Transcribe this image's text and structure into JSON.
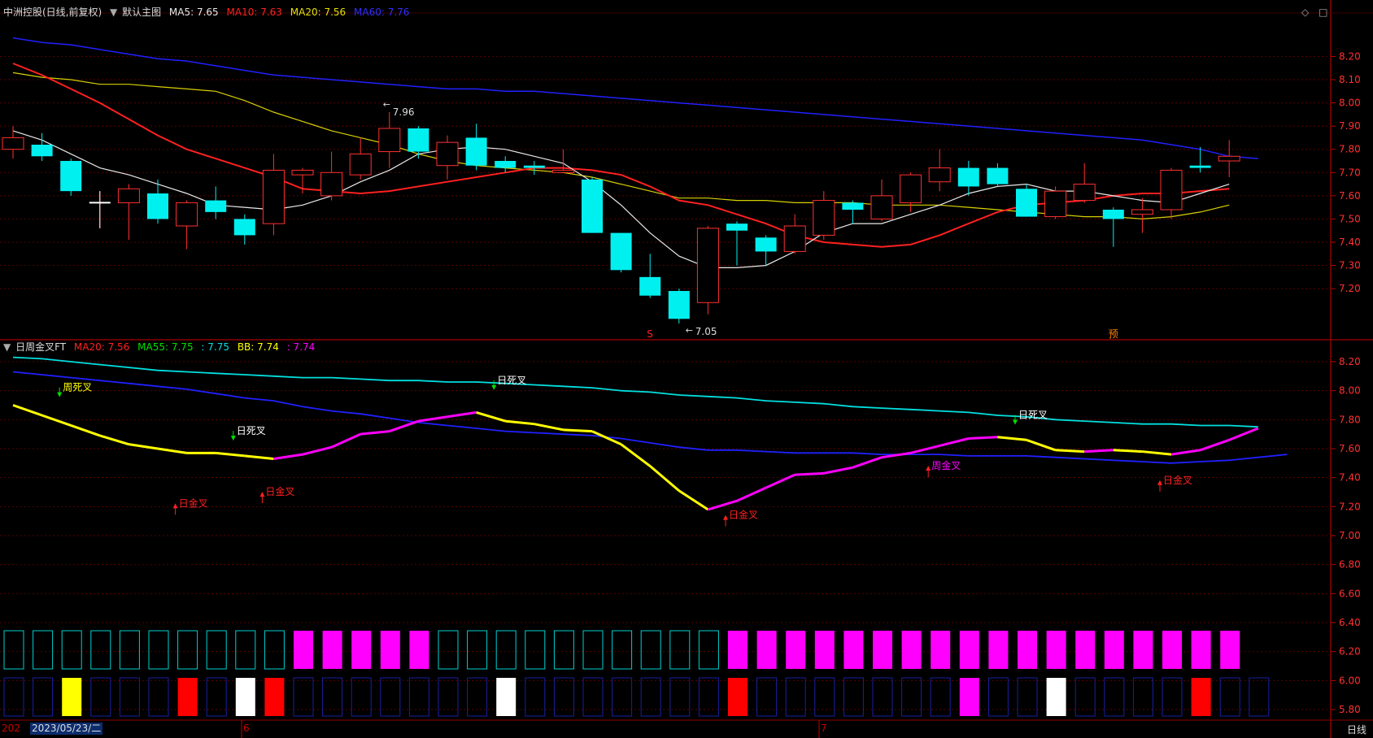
{
  "window": {
    "top_controls": [
      "◇",
      "□"
    ]
  },
  "main_panel": {
    "header": {
      "title": "中洲控股(日线,前复权)",
      "theme": "默认主图",
      "ma5": "MA5: 7.65",
      "ma10": "MA10: 7.63",
      "ma20": "MA20: 7.56",
      "ma60": "MA60: 7.76"
    },
    "colors": {
      "ma5": "#e8e8e8",
      "ma10": "#ff2020",
      "ma20": "#d8d000",
      "ma60": "#2020ff",
      "up": "#ff3030",
      "down": "#00f0f0"
    },
    "high_label": "7.96",
    "low_label": "7.05",
    "markers": [
      {
        "label": "S",
        "color": "#ff2020"
      },
      {
        "label": "预",
        "color": "#ff8000"
      }
    ]
  },
  "sub_panel": {
    "header": {
      "title": "日周金叉FT",
      "ma20": "MA20: 7.56",
      "ma55": "MA55: 7.75",
      "unnamed": ": 7.75",
      "bb": "BB: 7.74",
      "value": ": 7.74"
    },
    "signal_labels": [
      {
        "text": "周死叉",
        "color": "#ffff00",
        "arrow": "down"
      },
      {
        "text": "日死叉",
        "color": "#ffffff",
        "arrow": "down"
      },
      {
        "text": "日金叉",
        "color": "#ff2020",
        "arrow": "up"
      },
      {
        "text": "日金叉",
        "color": "#ff2020",
        "arrow": "up"
      },
      {
        "text": "日死叉",
        "color": "#ffffff",
        "arrow": "down"
      },
      {
        "text": "日金叉",
        "color": "#ff2020",
        "arrow": "up"
      },
      {
        "text": "周金叉",
        "color": "#ff00ff",
        "arrow": "up"
      },
      {
        "text": "日死叉",
        "color": "#ffffff",
        "arrow": "down"
      },
      {
        "text": "日金叉",
        "color": "#ff2020",
        "arrow": "up"
      }
    ]
  },
  "axis": {
    "main_ticks": [
      "8.20",
      "8.10",
      "8.00",
      "7.90",
      "7.80",
      "7.70",
      "7.60",
      "7.50",
      "7.40",
      "7.30",
      "7.20"
    ],
    "sub_ticks": [
      "8.20",
      "8.00",
      "7.80",
      "7.60",
      "7.40",
      "7.20",
      "7.00",
      "6.80",
      "6.60",
      "6.40",
      "6.20",
      "6.00",
      "5.80"
    ]
  },
  "bottom_bar": {
    "year_stub": "202",
    "cursor_date": "2023/05/23/二",
    "month_labels": [
      "6",
      "7"
    ],
    "period": "日线"
  },
  "chart_data": {
    "type": "candlestick",
    "candles": [
      {
        "o": 7.8,
        "c": 7.85,
        "h": 7.9,
        "l": 7.76
      },
      {
        "o": 7.82,
        "c": 7.77,
        "h": 7.87,
        "l": 7.75
      },
      {
        "o": 7.75,
        "c": 7.62,
        "h": 7.76,
        "l": 7.6
      },
      {
        "o": 7.57,
        "c": 7.57,
        "h": 7.62,
        "l": 7.46
      },
      {
        "o": 7.57,
        "c": 7.63,
        "h": 7.65,
        "l": 7.41
      },
      {
        "o": 7.61,
        "c": 7.5,
        "h": 7.67,
        "l": 7.48
      },
      {
        "o": 7.47,
        "c": 7.57,
        "h": 7.58,
        "l": 7.37
      },
      {
        "o": 7.58,
        "c": 7.53,
        "h": 7.64,
        "l": 7.5
      },
      {
        "o": 7.5,
        "c": 7.43,
        "h": 7.52,
        "l": 7.39
      },
      {
        "o": 7.48,
        "c": 7.71,
        "h": 7.78,
        "l": 7.43
      },
      {
        "o": 7.69,
        "c": 7.71,
        "h": 7.72,
        "l": 7.61
      },
      {
        "o": 7.6,
        "c": 7.7,
        "h": 7.79,
        "l": 7.58
      },
      {
        "o": 7.69,
        "c": 7.78,
        "h": 7.85,
        "l": 7.67
      },
      {
        "o": 7.79,
        "c": 7.89,
        "h": 7.96,
        "l": 7.72
      },
      {
        "o": 7.89,
        "c": 7.79,
        "h": 7.9,
        "l": 7.76
      },
      {
        "o": 7.73,
        "c": 7.83,
        "h": 7.86,
        "l": 7.67
      },
      {
        "o": 7.85,
        "c": 7.73,
        "h": 7.91,
        "l": 7.71
      },
      {
        "o": 7.75,
        "c": 7.72,
        "h": 7.77,
        "l": 7.7
      },
      {
        "o": 7.73,
        "c": 7.72,
        "h": 7.75,
        "l": 7.69
      },
      {
        "o": 7.7,
        "c": 7.71,
        "h": 7.8,
        "l": 7.7
      },
      {
        "o": 7.67,
        "c": 7.44,
        "h": 7.68,
        "l": 7.44
      },
      {
        "o": 7.44,
        "c": 7.28,
        "h": 7.44,
        "l": 7.27
      },
      {
        "o": 7.25,
        "c": 7.17,
        "h": 7.35,
        "l": 7.16
      },
      {
        "o": 7.19,
        "c": 7.07,
        "h": 7.2,
        "l": 7.05
      },
      {
        "o": 7.14,
        "c": 7.46,
        "h": 7.47,
        "l": 7.09
      },
      {
        "o": 7.48,
        "c": 7.45,
        "h": 7.49,
        "l": 7.3
      },
      {
        "o": 7.42,
        "c": 7.36,
        "h": 7.43,
        "l": 7.3
      },
      {
        "o": 7.36,
        "c": 7.47,
        "h": 7.52,
        "l": 7.35
      },
      {
        "o": 7.43,
        "c": 7.58,
        "h": 7.62,
        "l": 7.41
      },
      {
        "o": 7.57,
        "c": 7.54,
        "h": 7.58,
        "l": 7.48
      },
      {
        "o": 7.5,
        "c": 7.6,
        "h": 7.67,
        "l": 7.49
      },
      {
        "o": 7.57,
        "c": 7.69,
        "h": 7.7,
        "l": 7.53
      },
      {
        "o": 7.66,
        "c": 7.72,
        "h": 7.8,
        "l": 7.62
      },
      {
        "o": 7.72,
        "c": 7.64,
        "h": 7.75,
        "l": 7.6
      },
      {
        "o": 7.72,
        "c": 7.65,
        "h": 7.74,
        "l": 7.64
      },
      {
        "o": 7.63,
        "c": 7.51,
        "h": 7.65,
        "l": 7.51
      },
      {
        "o": 7.51,
        "c": 7.62,
        "h": 7.64,
        "l": 7.5
      },
      {
        "o": 7.58,
        "c": 7.65,
        "h": 7.74,
        "l": 7.57
      },
      {
        "o": 7.54,
        "c": 7.5,
        "h": 7.55,
        "l": 7.38
      },
      {
        "o": 7.52,
        "c": 7.54,
        "h": 7.59,
        "l": 7.44
      },
      {
        "o": 7.54,
        "c": 7.71,
        "h": 7.72,
        "l": 7.5
      },
      {
        "o": 7.73,
        "c": 7.72,
        "h": 7.81,
        "l": 7.7
      },
      {
        "o": 7.75,
        "c": 7.77,
        "h": 7.84,
        "l": 7.68
      }
    ],
    "ma5": [
      7.88,
      7.84,
      7.78,
      7.72,
      7.69,
      7.65,
      7.61,
      7.56,
      7.55,
      7.54,
      7.56,
      7.6,
      7.66,
      7.71,
      7.78,
      7.8,
      7.81,
      7.8,
      7.77,
      7.74,
      7.66,
      7.56,
      7.44,
      7.34,
      7.29,
      7.29,
      7.3,
      7.36,
      7.44,
      7.48,
      7.48,
      7.52,
      7.56,
      7.61,
      7.64,
      7.65,
      7.62,
      7.62,
      7.6,
      7.58,
      7.57,
      7.61,
      7.65
    ],
    "ma10": [
      8.17,
      8.12,
      8.06,
      8.0,
      7.93,
      7.86,
      7.8,
      7.76,
      7.72,
      7.68,
      7.63,
      7.62,
      7.61,
      7.62,
      7.64,
      7.66,
      7.68,
      7.7,
      7.72,
      7.72,
      7.71,
      7.69,
      7.64,
      7.58,
      7.56,
      7.52,
      7.48,
      7.43,
      7.4,
      7.39,
      7.38,
      7.39,
      7.43,
      7.48,
      7.53,
      7.56,
      7.57,
      7.58,
      7.6,
      7.61,
      7.61,
      7.62,
      7.63
    ],
    "ma20": [
      8.13,
      8.11,
      8.1,
      8.08,
      8.08,
      8.07,
      8.06,
      8.05,
      8.01,
      7.96,
      7.92,
      7.88,
      7.85,
      7.82,
      7.78,
      7.75,
      7.73,
      7.72,
      7.71,
      7.7,
      7.68,
      7.65,
      7.62,
      7.59,
      7.59,
      7.58,
      7.58,
      7.57,
      7.57,
      7.57,
      7.56,
      7.56,
      7.56,
      7.55,
      7.54,
      7.53,
      7.52,
      7.51,
      7.51,
      7.5,
      7.51,
      7.53,
      7.56
    ],
    "ma60": [
      8.28,
      8.26,
      8.25,
      8.23,
      8.21,
      8.19,
      8.18,
      8.16,
      8.14,
      8.12,
      8.11,
      8.1,
      8.09,
      8.08,
      8.07,
      8.06,
      8.06,
      8.05,
      8.05,
      8.04,
      8.03,
      8.02,
      8.01,
      8.0,
      7.99,
      7.98,
      7.97,
      7.96,
      7.95,
      7.94,
      7.93,
      7.92,
      7.91,
      7.9,
      7.89,
      7.88,
      7.87,
      7.86,
      7.85,
      7.84,
      7.82,
      7.8,
      7.77,
      7.76
    ],
    "sub": {
      "ma55": [
        8.23,
        8.22,
        8.2,
        8.18,
        8.16,
        8.14,
        8.13,
        8.12,
        8.11,
        8.1,
        8.09,
        8.09,
        8.08,
        8.07,
        8.07,
        8.06,
        8.06,
        8.05,
        8.04,
        8.03,
        8.02,
        8.0,
        7.99,
        7.97,
        7.96,
        7.95,
        7.93,
        7.92,
        7.91,
        7.89,
        7.88,
        7.87,
        7.86,
        7.85,
        7.83,
        7.82,
        7.8,
        7.79,
        7.78,
        7.77,
        7.77,
        7.76,
        7.76,
        7.75
      ],
      "ma20": [
        8.13,
        8.11,
        8.09,
        8.07,
        8.05,
        8.03,
        8.01,
        7.98,
        7.95,
        7.93,
        7.89,
        7.86,
        7.84,
        7.81,
        7.78,
        7.76,
        7.74,
        7.72,
        7.71,
        7.7,
        7.69,
        7.67,
        7.64,
        7.61,
        7.59,
        7.59,
        7.58,
        7.57,
        7.57,
        7.57,
        7.56,
        7.56,
        7.56,
        7.55,
        7.55,
        7.55,
        7.54,
        7.53,
        7.52,
        7.51,
        7.5,
        7.51,
        7.52,
        7.54,
        7.56
      ],
      "bb": [
        7.9,
        7.83,
        7.76,
        7.69,
        7.63,
        7.6,
        7.57,
        7.57,
        7.55,
        7.53,
        7.56,
        7.61,
        7.7,
        7.72,
        7.79,
        7.82,
        7.85,
        7.79,
        7.77,
        7.73,
        7.72,
        7.63,
        7.48,
        7.31,
        7.18,
        7.24,
        7.33,
        7.42,
        7.43,
        7.47,
        7.54,
        7.57,
        7.62,
        7.67,
        7.68,
        7.66,
        7.59,
        7.58,
        7.59,
        7.58,
        7.56,
        7.59,
        7.66,
        7.74
      ],
      "week_bars": [
        0,
        0,
        0,
        0,
        0,
        0,
        0,
        0,
        0,
        0,
        1,
        1,
        1,
        1,
        1,
        0,
        0,
        0,
        0,
        0,
        0,
        0,
        0,
        0,
        0,
        1,
        1,
        1,
        1,
        1,
        1,
        1,
        1,
        1,
        1,
        1,
        1,
        1,
        1,
        1,
        1,
        1,
        1
      ],
      "day_bars": [
        "",
        "",
        "yellow",
        "",
        "",
        "",
        "red",
        "",
        "white",
        "red",
        "",
        "",
        "",
        "",
        "",
        "",
        "",
        "white",
        "",
        "",
        "",
        "",
        "",
        "",
        "",
        "red",
        "",
        "",
        "",
        "",
        "",
        "",
        "",
        "magenta",
        "",
        "",
        "white",
        "",
        "",
        "",
        "",
        "red",
        "",
        ""
      ]
    }
  }
}
